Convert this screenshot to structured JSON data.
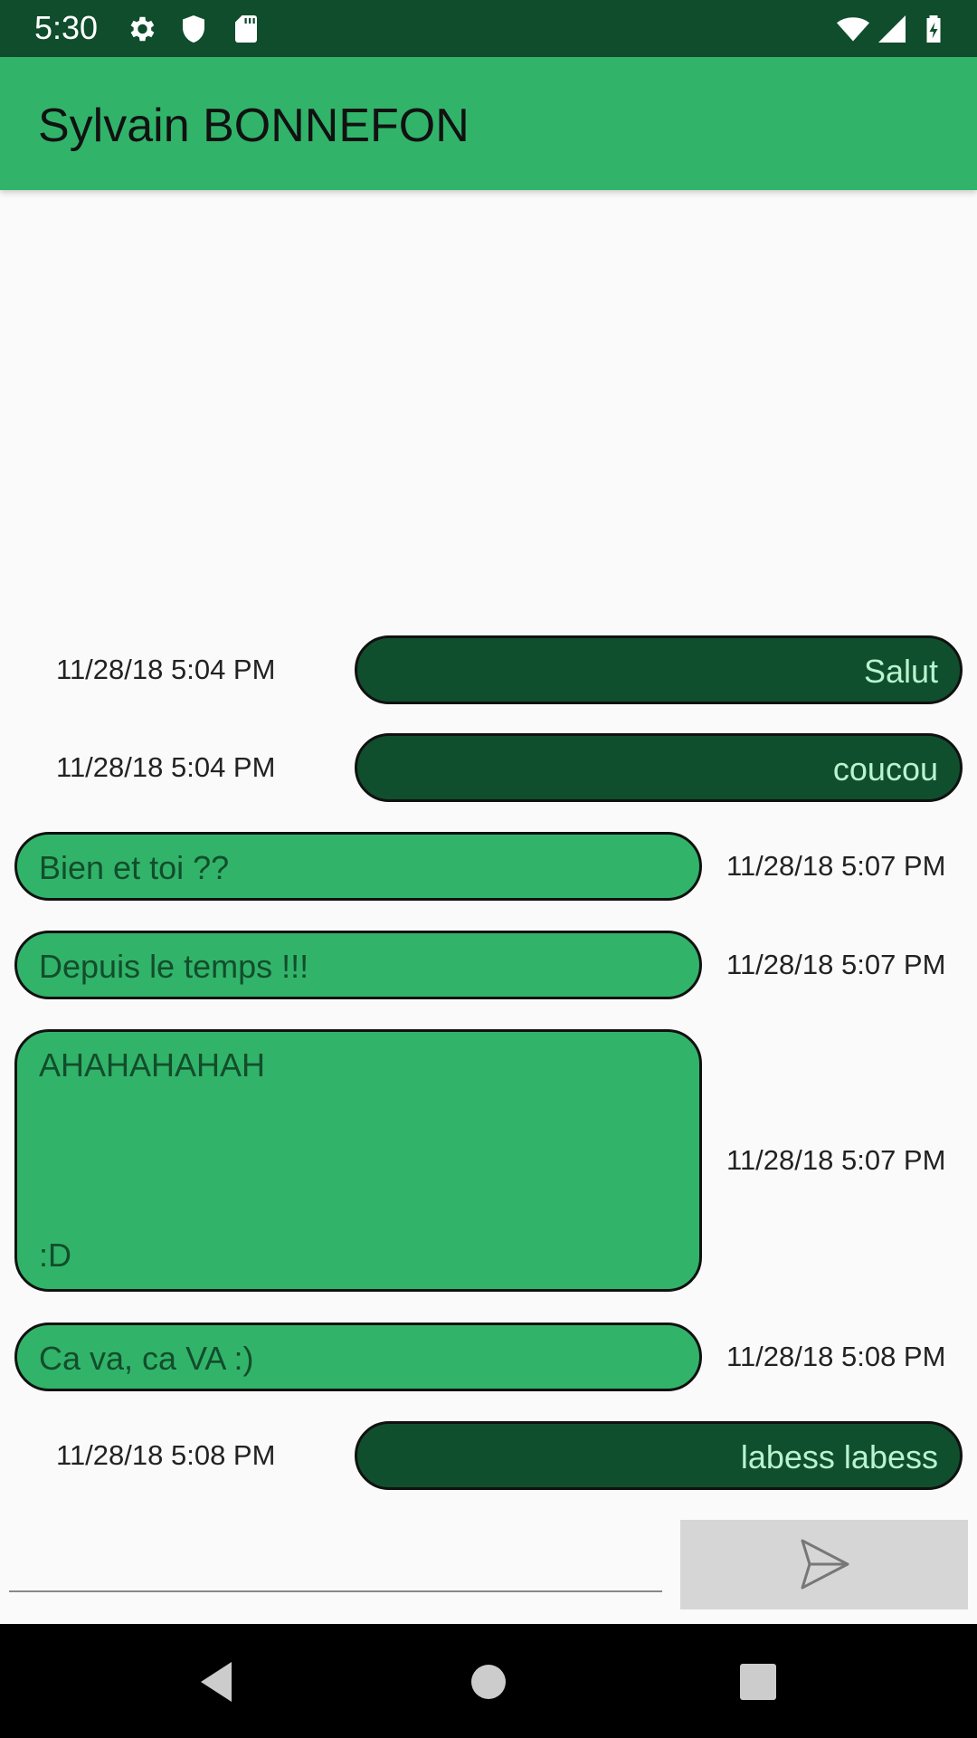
{
  "status_bar": {
    "time": "5:30",
    "icons": [
      "gear-icon",
      "shield-icon",
      "sd-card-icon",
      "wifi-icon",
      "signal-icon",
      "battery-icon"
    ]
  },
  "app_bar": {
    "title": "Sylvain BONNEFON"
  },
  "messages": [
    {
      "direction": "sent",
      "text": "Salut",
      "timestamp": "11/28/18 5:04 PM"
    },
    {
      "direction": "sent",
      "text": "coucou",
      "timestamp": "11/28/18 5:04 PM"
    },
    {
      "direction": "received",
      "text": "Bien et toi ??",
      "timestamp": "11/28/18 5:07 PM"
    },
    {
      "direction": "received",
      "text": "Depuis le temps !!!",
      "timestamp": "11/28/18 5:07 PM"
    },
    {
      "direction": "received",
      "text_line1": "AHAHAHAHAH",
      "text_line2": ":D",
      "timestamp": "11/28/18 5:07 PM"
    },
    {
      "direction": "received",
      "text": "Ca va, ca VA :)",
      "timestamp": "11/28/18 5:08 PM"
    },
    {
      "direction": "sent",
      "text": "labess labess",
      "timestamp": "11/28/18 5:08 PM"
    }
  ],
  "composer": {
    "input_value": "",
    "send_icon": "send-icon"
  },
  "nav_bar": {
    "icons": [
      "back-icon",
      "home-icon",
      "recents-icon"
    ]
  },
  "colors": {
    "status_bar": "#0f4d2c",
    "app_bar": "#31b46a",
    "sent_bubble": "#104f2d",
    "sent_text": "#b9f3cf",
    "received_bubble": "#31b46a",
    "received_text": "#134d2b"
  }
}
